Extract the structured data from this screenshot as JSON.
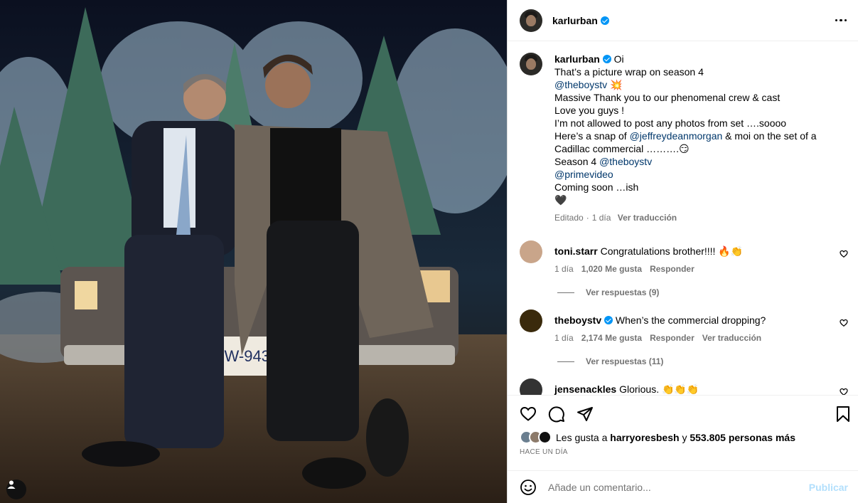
{
  "post": {
    "username": "karlurban",
    "verified": true,
    "caption": {
      "lines": [
        {
          "parts": [
            {
              "t": "karlurban",
              "bold": true
            },
            {
              "t": " "
            },
            {
              "t": "verified",
              "badge": true
            },
            {
              "t": " Oi"
            }
          ]
        },
        {
          "parts": [
            {
              "t": "That’s a picture wrap on season 4"
            }
          ]
        },
        {
          "parts": [
            {
              "t": "@theboystv",
              "link": true
            },
            {
              "t": " 💥"
            }
          ]
        },
        {
          "parts": [
            {
              "t": "Massive Thank you to our phenomenal crew & cast"
            }
          ]
        },
        {
          "parts": [
            {
              "t": "Love you guys !"
            }
          ]
        },
        {
          "parts": [
            {
              "t": "I’m not allowed to post any photos from set ….soooo"
            }
          ]
        },
        {
          "parts": [
            {
              "t": "Here’s a snap of "
            },
            {
              "t": "@jeffreydeanmorgan",
              "link": true
            },
            {
              "t": " & moi on the set of a"
            }
          ]
        },
        {
          "parts": [
            {
              "t": "Cadillac commercial ……….😏"
            }
          ]
        },
        {
          "parts": [
            {
              "t": "Season 4 "
            },
            {
              "t": "@theboystv",
              "link": true
            }
          ]
        },
        {
          "parts": [
            {
              "t": "@primevideo",
              "link": true
            }
          ]
        },
        {
          "parts": [
            {
              "t": "Coming soon …ish"
            }
          ]
        },
        {
          "parts": [
            {
              "t": "🖤"
            }
          ]
        }
      ],
      "edited_label": "Editado",
      "time": "1 día",
      "see_translation": "Ver traducción"
    },
    "comments": [
      {
        "username": "toni.starr",
        "verified": false,
        "text": "Congratulations brother!!!! 🔥👏",
        "time": "1 día",
        "likes": "1,020 Me gusta",
        "reply": "Responder",
        "translation": "",
        "replies_label": "Ver respuestas (9)",
        "avatar_color": "#c9a58a"
      },
      {
        "username": "theboystv",
        "verified": true,
        "text": "When’s the commercial dropping?",
        "time": "1 día",
        "likes": "2,174 Me gusta",
        "reply": "Responder",
        "translation": "Ver traducción",
        "replies_label": "Ver respuestas (11)",
        "avatar_color": "#3a2a0c"
      },
      {
        "username": "jensenackles",
        "verified": false,
        "text": "Glorious. 👏👏👏",
        "time": "",
        "likes": "",
        "reply": "",
        "translation": "",
        "replies_label": "",
        "avatar_color": "#333333"
      }
    ],
    "likes_line": {
      "prefix": "Les gusta a ",
      "user": "harryoresbesh",
      "middle": " y ",
      "count": "553.805 personas más"
    },
    "time_ago": "HACE UN DÍA",
    "comment_placeholder": "Añade un comentario...",
    "publish_label": "Publicar",
    "icons": [
      "heart-icon",
      "comment-icon",
      "share-icon",
      "bookmark-icon",
      "emoji-icon",
      "more-icon",
      "user-tag-icon"
    ],
    "colors": {
      "link": "#00376b",
      "verified": "#0095f6",
      "muted": "#737373",
      "publish": "#b2dffc"
    }
  }
}
